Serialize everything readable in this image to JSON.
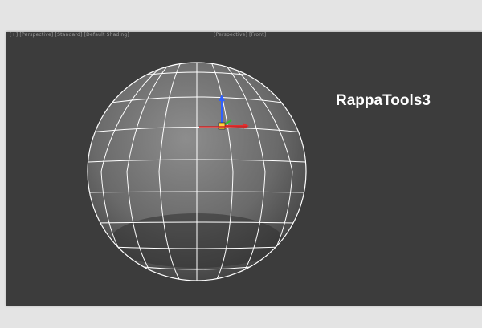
{
  "viewport": {
    "label_left": "[+] [Perspective] [Standard] [Default Shading]",
    "label_center": "[Perspective] [Front]"
  },
  "watermark": "RappaTools3",
  "colors": {
    "viewport_bg": "#3c3c3c",
    "wire": "#ffffff",
    "gizmo_x": "#e03030",
    "gizmo_y": "#30c030",
    "gizmo_z": "#3060ff"
  },
  "gizmo_icon": "transform-gizmo-icon"
}
